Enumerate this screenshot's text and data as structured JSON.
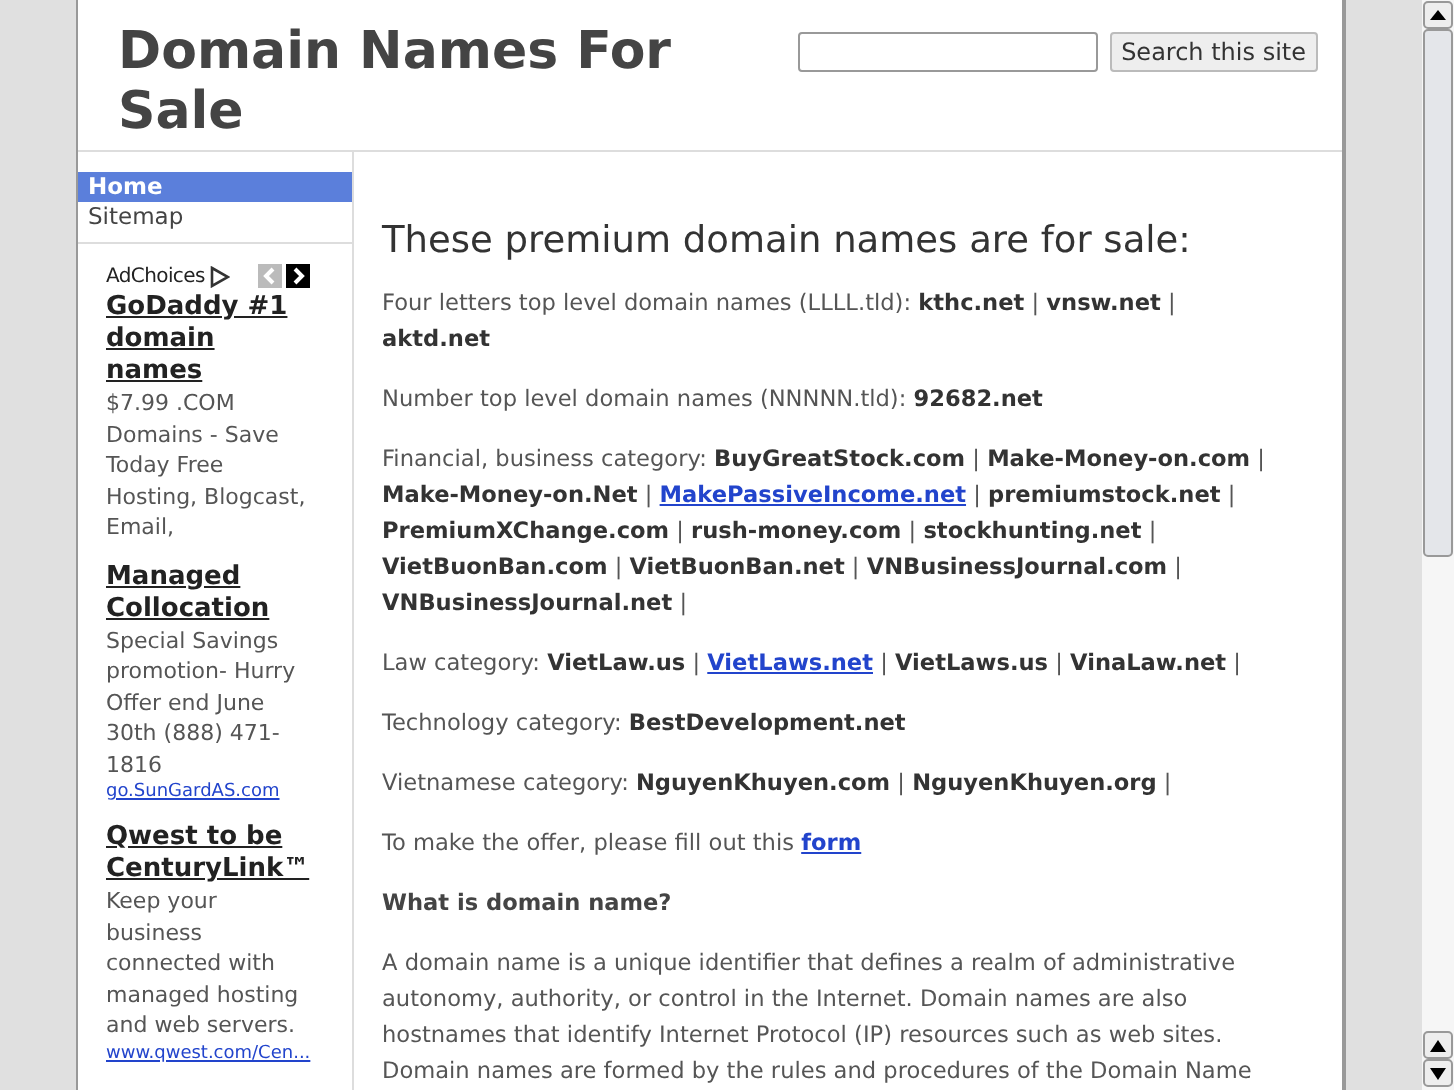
{
  "header": {
    "title": "Domain Names For Sale",
    "search": {
      "button": "Search this site"
    }
  },
  "nav": [
    {
      "label": "Home",
      "selected": true
    },
    {
      "label": "Sitemap",
      "selected": false
    }
  ],
  "ads": {
    "label": "AdChoices",
    "items": [
      {
        "title": "GoDaddy #1 domain names",
        "body": "$7.99 .COM Domains - Save Today Free Hosting, Blogcast, Email,"
      },
      {
        "title": "Managed Collocation",
        "body": "Special Savings promotion- Hurry Offer end June 30th (888) 471-1816",
        "url": "go.SunGardAS.com"
      },
      {
        "title": "Qwest to be CenturyLink™",
        "body": "Keep your business connected with managed hosting and web servers.",
        "url": "www.qwest.com/Cen..."
      }
    ]
  },
  "content": {
    "heading": "These premium domain names are for sale:",
    "paragraphs": [
      {
        "kind": "text",
        "segments": [
          {
            "kind": "plain",
            "text": "Four letters top level domain names (LLLL.tld):  "
          },
          {
            "kind": "bold",
            "text": "kthc.net"
          },
          {
            "kind": "plain",
            "text": " | "
          },
          {
            "kind": "bold",
            "text": "vnsw.net"
          },
          {
            "kind": "plain",
            "text": " | "
          },
          {
            "kind": "bold",
            "text": "aktd.net"
          }
        ]
      },
      {
        "kind": "text",
        "segments": [
          {
            "kind": "plain",
            "text": "Number top level domain names (NNNNN.tld):  "
          },
          {
            "kind": "bold",
            "text": "92682.net"
          }
        ]
      },
      {
        "kind": "text",
        "segments": [
          {
            "kind": "plain",
            "text": "Financial, business category: "
          },
          {
            "kind": "bold",
            "text": "BuyGreatStock.com"
          },
          {
            "kind": "plain",
            "text": " | "
          },
          {
            "kind": "bold",
            "text": "Make-Money-on.com"
          },
          {
            "kind": "plain",
            "text": " | "
          },
          {
            "kind": "bold",
            "text": "Make-Money-on.Net"
          },
          {
            "kind": "plain",
            "text": " | "
          },
          {
            "kind": "link",
            "text": "MakePassiveIncome.net"
          },
          {
            "kind": "plain",
            "text": " | "
          },
          {
            "kind": "bold",
            "text": "premiumstock.net"
          },
          {
            "kind": "plain",
            "text": " | "
          },
          {
            "kind": "bold",
            "text": "PremiumXChange.com"
          },
          {
            "kind": "plain",
            "text": " | "
          },
          {
            "kind": "bold",
            "text": "rush-money.com"
          },
          {
            "kind": "plain",
            "text": " | "
          },
          {
            "kind": "bold",
            "text": "stockhunting.net"
          },
          {
            "kind": "plain",
            "text": " | "
          },
          {
            "kind": "bold",
            "text": "VietBuonBan.com"
          },
          {
            "kind": "plain",
            "text": " | "
          },
          {
            "kind": "bold",
            "text": "VietBuonBan.net"
          },
          {
            "kind": "plain",
            "text": " | "
          },
          {
            "kind": "bold",
            "text": "VNBusinessJournal.com"
          },
          {
            "kind": "plain",
            "text": " | "
          },
          {
            "kind": "bold",
            "text": "VNBusinessJournal.net"
          },
          {
            "kind": "plain",
            "text": " |"
          }
        ]
      },
      {
        "kind": "text",
        "segments": [
          {
            "kind": "plain",
            "text": "Law category: "
          },
          {
            "kind": "bold",
            "text": "VietLaw.us"
          },
          {
            "kind": "plain",
            "text": " | "
          },
          {
            "kind": "link",
            "text": "VietLaws.net"
          },
          {
            "kind": "plain",
            "text": " | "
          },
          {
            "kind": "bold",
            "text": "VietLaws.us"
          },
          {
            "kind": "plain",
            "text": " | "
          },
          {
            "kind": "bold",
            "text": "VinaLaw.net"
          },
          {
            "kind": "plain",
            "text": " |"
          }
        ]
      },
      {
        "kind": "text",
        "segments": [
          {
            "kind": "plain",
            "text": "Technology category: "
          },
          {
            "kind": "bold",
            "text": "BestDevelopment.net"
          }
        ]
      },
      {
        "kind": "text",
        "segments": [
          {
            "kind": "plain",
            "text": "Vietnamese category: "
          },
          {
            "kind": "bold",
            "text": "NguyenKhuyen.com"
          },
          {
            "kind": "plain",
            "text": " | "
          },
          {
            "kind": "bold",
            "text": "NguyenKhuyen.org"
          },
          {
            "kind": "plain",
            "text": " |"
          }
        ]
      },
      {
        "kind": "text",
        "segments": [
          {
            "kind": "plain",
            "text": "To make the offer, please fill out this "
          },
          {
            "kind": "link",
            "text": "form"
          }
        ]
      },
      {
        "kind": "subheading",
        "segments": [
          {
            "kind": "plain",
            "text": "What is domain name?"
          }
        ]
      },
      {
        "kind": "text",
        "segments": [
          {
            "kind": "plain",
            "text": "A domain name is a unique identifier that defines a realm of administrative autonomy, authority, or control in the Internet. Domain names are also hostnames that identify Internet Protocol (IP) resources such as web sites. Domain names are formed by the rules and procedures of the Domain Name"
          }
        ]
      }
    ]
  }
}
